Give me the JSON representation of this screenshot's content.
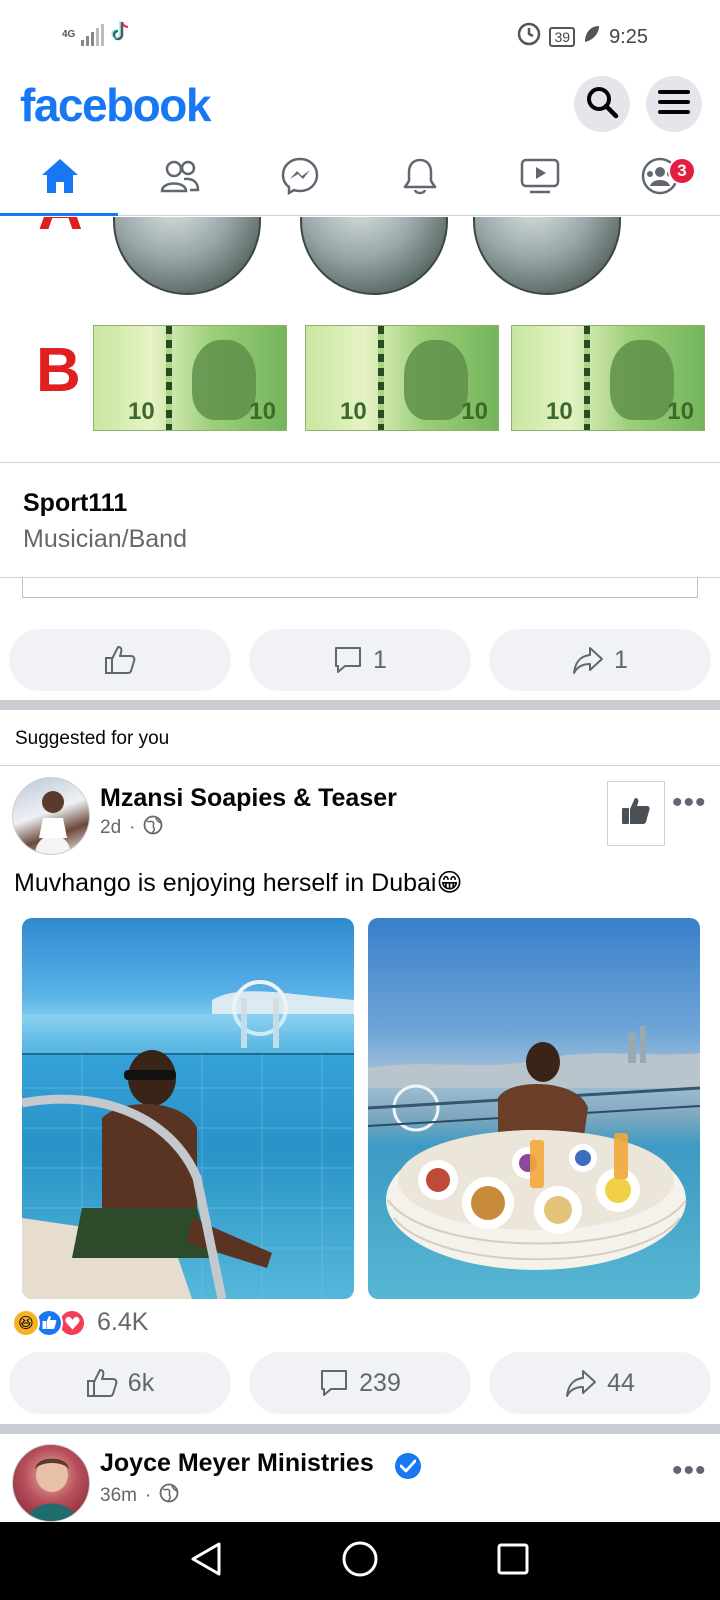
{
  "status_bar": {
    "network": "4G",
    "battery": "39",
    "time": "9:25"
  },
  "header": {
    "logo": "facebook"
  },
  "nav": {
    "badge_count": "3"
  },
  "post1": {
    "image_labels": [
      "A",
      "B"
    ],
    "note_value": "10",
    "link_title": "Sport111",
    "link_subtitle": "Musician/Band",
    "comments": "1",
    "shares": "1"
  },
  "suggested": {
    "label": "Suggested for you"
  },
  "post2": {
    "page_name": "Mzansi Soapies & Teaser",
    "age": "2d",
    "separator": "·",
    "text": "Muvhango is enjoying herself in Dubai😁",
    "reaction_count": "6.4K",
    "likes": "6k",
    "comments": "239",
    "shares": "44"
  },
  "post3": {
    "page_name": "Joyce Meyer Ministries",
    "age": "36m",
    "separator": "·"
  },
  "colors": {
    "brand": "#1877f2",
    "badge": "#e41e3f",
    "pill_bg": "#f0f2f5",
    "separator": "#c9ccd1"
  }
}
